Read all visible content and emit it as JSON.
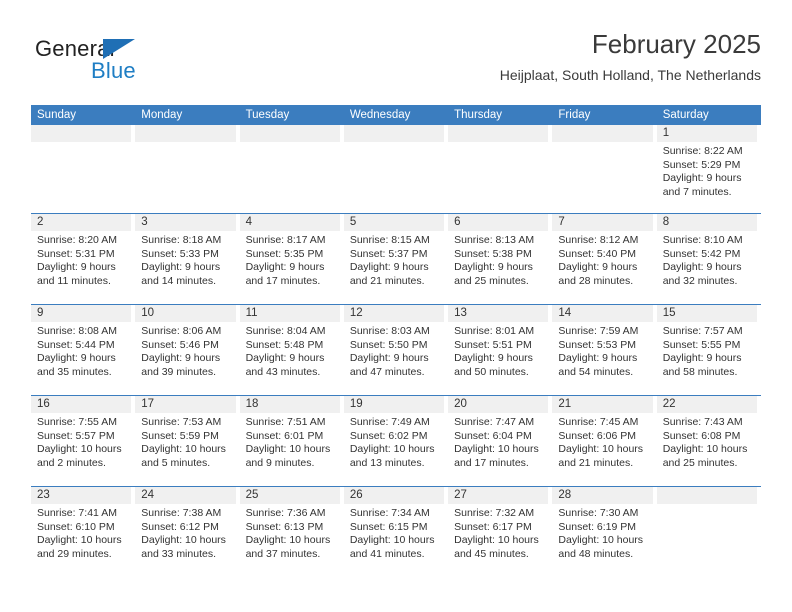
{
  "brand": {
    "name_part1": "General",
    "name_part2": "Blue",
    "color_dark": "#222222",
    "color_blue": "#1f7ec4"
  },
  "header": {
    "title": "February 2025",
    "subtitle": "Heijplaat, South Holland, The Netherlands"
  },
  "theme": {
    "header_bg": "#3b7dbf",
    "daynum_bg": "#f0f0f0",
    "text": "#333333"
  },
  "calendar": {
    "weekdays": [
      "Sunday",
      "Monday",
      "Tuesday",
      "Wednesday",
      "Thursday",
      "Friday",
      "Saturday"
    ],
    "weeks": [
      [
        {
          "day": "",
          "sunrise": "",
          "sunset": "",
          "daylight_line1": "",
          "daylight_line2": "",
          "empty": true
        },
        {
          "day": "",
          "sunrise": "",
          "sunset": "",
          "daylight_line1": "",
          "daylight_line2": "",
          "empty": true
        },
        {
          "day": "",
          "sunrise": "",
          "sunset": "",
          "daylight_line1": "",
          "daylight_line2": "",
          "empty": true
        },
        {
          "day": "",
          "sunrise": "",
          "sunset": "",
          "daylight_line1": "",
          "daylight_line2": "",
          "empty": true
        },
        {
          "day": "",
          "sunrise": "",
          "sunset": "",
          "daylight_line1": "",
          "daylight_line2": "",
          "empty": true
        },
        {
          "day": "",
          "sunrise": "",
          "sunset": "",
          "daylight_line1": "",
          "daylight_line2": "",
          "empty": true
        },
        {
          "day": "1",
          "sunrise": "Sunrise: 8:22 AM",
          "sunset": "Sunset: 5:29 PM",
          "daylight_line1": "Daylight: 9 hours",
          "daylight_line2": "and 7 minutes.",
          "empty": false
        }
      ],
      [
        {
          "day": "2",
          "sunrise": "Sunrise: 8:20 AM",
          "sunset": "Sunset: 5:31 PM",
          "daylight_line1": "Daylight: 9 hours",
          "daylight_line2": "and 11 minutes.",
          "empty": false
        },
        {
          "day": "3",
          "sunrise": "Sunrise: 8:18 AM",
          "sunset": "Sunset: 5:33 PM",
          "daylight_line1": "Daylight: 9 hours",
          "daylight_line2": "and 14 minutes.",
          "empty": false
        },
        {
          "day": "4",
          "sunrise": "Sunrise: 8:17 AM",
          "sunset": "Sunset: 5:35 PM",
          "daylight_line1": "Daylight: 9 hours",
          "daylight_line2": "and 17 minutes.",
          "empty": false
        },
        {
          "day": "5",
          "sunrise": "Sunrise: 8:15 AM",
          "sunset": "Sunset: 5:37 PM",
          "daylight_line1": "Daylight: 9 hours",
          "daylight_line2": "and 21 minutes.",
          "empty": false
        },
        {
          "day": "6",
          "sunrise": "Sunrise: 8:13 AM",
          "sunset": "Sunset: 5:38 PM",
          "daylight_line1": "Daylight: 9 hours",
          "daylight_line2": "and 25 minutes.",
          "empty": false
        },
        {
          "day": "7",
          "sunrise": "Sunrise: 8:12 AM",
          "sunset": "Sunset: 5:40 PM",
          "daylight_line1": "Daylight: 9 hours",
          "daylight_line2": "and 28 minutes.",
          "empty": false
        },
        {
          "day": "8",
          "sunrise": "Sunrise: 8:10 AM",
          "sunset": "Sunset: 5:42 PM",
          "daylight_line1": "Daylight: 9 hours",
          "daylight_line2": "and 32 minutes.",
          "empty": false
        }
      ],
      [
        {
          "day": "9",
          "sunrise": "Sunrise: 8:08 AM",
          "sunset": "Sunset: 5:44 PM",
          "daylight_line1": "Daylight: 9 hours",
          "daylight_line2": "and 35 minutes.",
          "empty": false
        },
        {
          "day": "10",
          "sunrise": "Sunrise: 8:06 AM",
          "sunset": "Sunset: 5:46 PM",
          "daylight_line1": "Daylight: 9 hours",
          "daylight_line2": "and 39 minutes.",
          "empty": false
        },
        {
          "day": "11",
          "sunrise": "Sunrise: 8:04 AM",
          "sunset": "Sunset: 5:48 PM",
          "daylight_line1": "Daylight: 9 hours",
          "daylight_line2": "and 43 minutes.",
          "empty": false
        },
        {
          "day": "12",
          "sunrise": "Sunrise: 8:03 AM",
          "sunset": "Sunset: 5:50 PM",
          "daylight_line1": "Daylight: 9 hours",
          "daylight_line2": "and 47 minutes.",
          "empty": false
        },
        {
          "day": "13",
          "sunrise": "Sunrise: 8:01 AM",
          "sunset": "Sunset: 5:51 PM",
          "daylight_line1": "Daylight: 9 hours",
          "daylight_line2": "and 50 minutes.",
          "empty": false
        },
        {
          "day": "14",
          "sunrise": "Sunrise: 7:59 AM",
          "sunset": "Sunset: 5:53 PM",
          "daylight_line1": "Daylight: 9 hours",
          "daylight_line2": "and 54 minutes.",
          "empty": false
        },
        {
          "day": "15",
          "sunrise": "Sunrise: 7:57 AM",
          "sunset": "Sunset: 5:55 PM",
          "daylight_line1": "Daylight: 9 hours",
          "daylight_line2": "and 58 minutes.",
          "empty": false
        }
      ],
      [
        {
          "day": "16",
          "sunrise": "Sunrise: 7:55 AM",
          "sunset": "Sunset: 5:57 PM",
          "daylight_line1": "Daylight: 10 hours",
          "daylight_line2": "and 2 minutes.",
          "empty": false
        },
        {
          "day": "17",
          "sunrise": "Sunrise: 7:53 AM",
          "sunset": "Sunset: 5:59 PM",
          "daylight_line1": "Daylight: 10 hours",
          "daylight_line2": "and 5 minutes.",
          "empty": false
        },
        {
          "day": "18",
          "sunrise": "Sunrise: 7:51 AM",
          "sunset": "Sunset: 6:01 PM",
          "daylight_line1": "Daylight: 10 hours",
          "daylight_line2": "and 9 minutes.",
          "empty": false
        },
        {
          "day": "19",
          "sunrise": "Sunrise: 7:49 AM",
          "sunset": "Sunset: 6:02 PM",
          "daylight_line1": "Daylight: 10 hours",
          "daylight_line2": "and 13 minutes.",
          "empty": false
        },
        {
          "day": "20",
          "sunrise": "Sunrise: 7:47 AM",
          "sunset": "Sunset: 6:04 PM",
          "daylight_line1": "Daylight: 10 hours",
          "daylight_line2": "and 17 minutes.",
          "empty": false
        },
        {
          "day": "21",
          "sunrise": "Sunrise: 7:45 AM",
          "sunset": "Sunset: 6:06 PM",
          "daylight_line1": "Daylight: 10 hours",
          "daylight_line2": "and 21 minutes.",
          "empty": false
        },
        {
          "day": "22",
          "sunrise": "Sunrise: 7:43 AM",
          "sunset": "Sunset: 6:08 PM",
          "daylight_line1": "Daylight: 10 hours",
          "daylight_line2": "and 25 minutes.",
          "empty": false
        }
      ],
      [
        {
          "day": "23",
          "sunrise": "Sunrise: 7:41 AM",
          "sunset": "Sunset: 6:10 PM",
          "daylight_line1": "Daylight: 10 hours",
          "daylight_line2": "and 29 minutes.",
          "empty": false
        },
        {
          "day": "24",
          "sunrise": "Sunrise: 7:38 AM",
          "sunset": "Sunset: 6:12 PM",
          "daylight_line1": "Daylight: 10 hours",
          "daylight_line2": "and 33 minutes.",
          "empty": false
        },
        {
          "day": "25",
          "sunrise": "Sunrise: 7:36 AM",
          "sunset": "Sunset: 6:13 PM",
          "daylight_line1": "Daylight: 10 hours",
          "daylight_line2": "and 37 minutes.",
          "empty": false
        },
        {
          "day": "26",
          "sunrise": "Sunrise: 7:34 AM",
          "sunset": "Sunset: 6:15 PM",
          "daylight_line1": "Daylight: 10 hours",
          "daylight_line2": "and 41 minutes.",
          "empty": false
        },
        {
          "day": "27",
          "sunrise": "Sunrise: 7:32 AM",
          "sunset": "Sunset: 6:17 PM",
          "daylight_line1": "Daylight: 10 hours",
          "daylight_line2": "and 45 minutes.",
          "empty": false
        },
        {
          "day": "28",
          "sunrise": "Sunrise: 7:30 AM",
          "sunset": "Sunset: 6:19 PM",
          "daylight_line1": "Daylight: 10 hours",
          "daylight_line2": "and 48 minutes.",
          "empty": false
        },
        {
          "day": "",
          "sunrise": "",
          "sunset": "",
          "daylight_line1": "",
          "daylight_line2": "",
          "empty": true
        }
      ]
    ]
  }
}
